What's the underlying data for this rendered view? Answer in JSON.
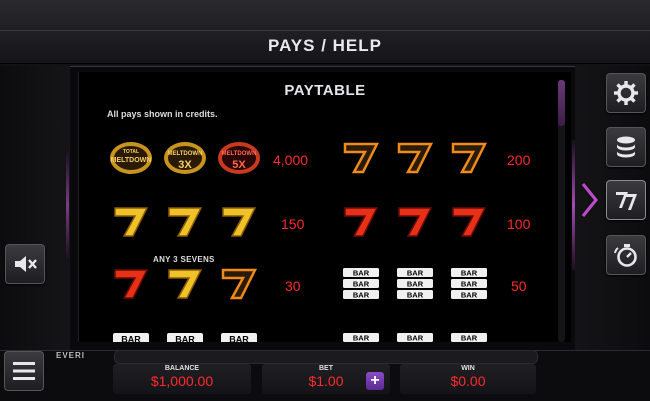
{
  "header": {
    "title": "PAYS / HELP"
  },
  "panel": {
    "title": "PAYTABLE",
    "note": "All pays shown in credits.",
    "any_label": "ANY 3 SEVENS"
  },
  "paytable": {
    "left": [
      {
        "symbols": [
          "TOTAL MELTDOWN",
          "TOTAL MELTDOWN 3X",
          "TOTAL MELTDOWN 5X"
        ],
        "pay": "4,000"
      },
      {
        "symbols": [
          "gold-seven",
          "gold-seven",
          "gold-seven"
        ],
        "pay": "150"
      },
      {
        "symbols": [
          "red-seven",
          "gold-seven",
          "orange-seven"
        ],
        "pay": "30"
      },
      {
        "symbols": [
          "BAR",
          "BAR",
          "BAR"
        ],
        "pay": ""
      }
    ],
    "right": [
      {
        "symbols": [
          "orange-seven",
          "orange-seven",
          "orange-seven"
        ],
        "pay": "200"
      },
      {
        "symbols": [
          "red-seven",
          "red-seven",
          "red-seven"
        ],
        "pay": "100"
      },
      {
        "symbols": [
          "BAR BAR BAR",
          "BAR BAR BAR",
          "BAR BAR BAR"
        ],
        "pay": "50"
      },
      {
        "symbols": [
          "BAR BAR",
          "BAR BAR",
          "BAR BAR"
        ],
        "pay": ""
      }
    ]
  },
  "symbol_text": {
    "meltdown_top": "TOTAL",
    "meltdown_main": "MELTDOWN",
    "mult_3x": "3X",
    "mult_5x": "5X",
    "bar": "BAR"
  },
  "sidebar": {
    "icons": [
      "speaker-mute-icon",
      "gear-icon",
      "coin-stack-icon",
      "seven-icon",
      "stopwatch-icon"
    ]
  },
  "footer": {
    "brand": "EVERI",
    "balance_label": "BALANCE",
    "balance_value": "$1,000.00",
    "bet_label": "BET",
    "bet_value": "$1.00",
    "plus": "+",
    "win_label": "WIN",
    "win_value": "$0.00"
  },
  "colors": {
    "accent": "#7a3c84",
    "value_red": "#ff2a2a",
    "plus_purple": "#7a3cb8"
  }
}
